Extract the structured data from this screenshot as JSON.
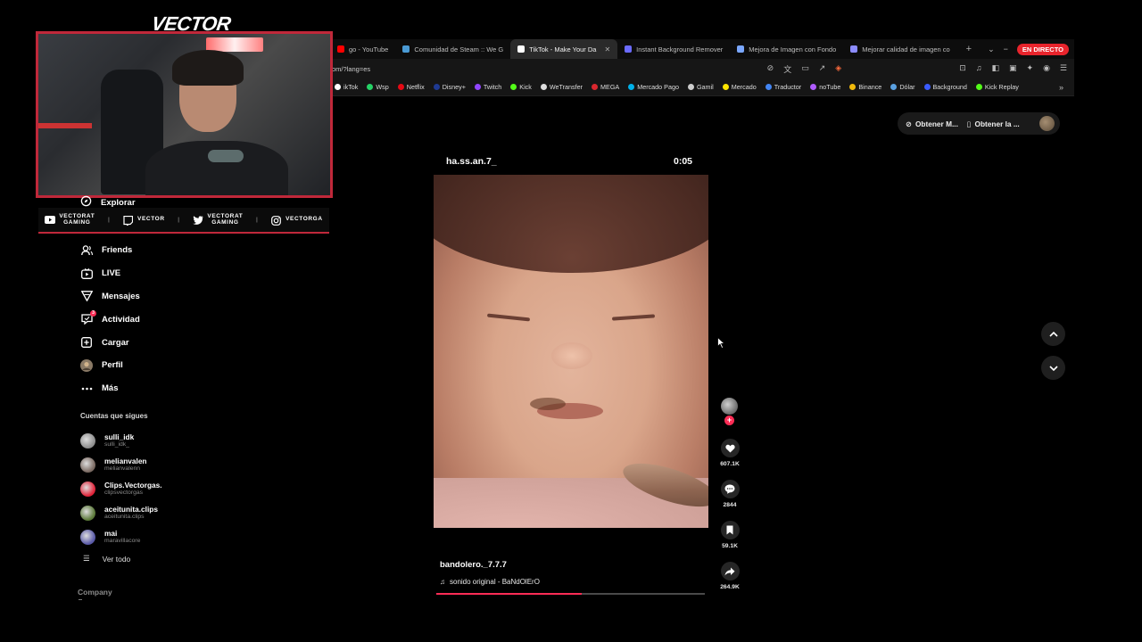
{
  "colors": {
    "accent": "#fe2c55",
    "live": "#e8242c",
    "webcam_border": "#c0283a"
  },
  "browser": {
    "tabs": [
      {
        "label": "go - YouTube",
        "icon": "youtube-icon",
        "color": "#ff0000",
        "active": false
      },
      {
        "label": "Comunidad de Steam :: We G",
        "icon": "steam-icon",
        "color": "#4a9ad4",
        "active": false
      },
      {
        "label": "TikTok - Make Your Da",
        "icon": "tiktok-icon",
        "color": "#ffffff",
        "active": true
      },
      {
        "label": "Instant Background Remover",
        "icon": "remover-icon",
        "color": "#6b6bff",
        "active": false
      },
      {
        "label": "Mejora de Imagen con Fondo",
        "icon": "sparkle-icon",
        "color": "#7aa7ff",
        "active": false
      },
      {
        "label": "Mejorar calidad de imagen co",
        "icon": "image-icon",
        "color": "#8c8cff",
        "active": false
      }
    ],
    "live_label": "EN DIRECTO",
    "url": "om/?lang=es",
    "bookmarks": [
      {
        "label": "ikTok",
        "color": "#ffffff"
      },
      {
        "label": "Wsp",
        "color": "#25d366"
      },
      {
        "label": "Netflix",
        "color": "#e50914"
      },
      {
        "label": "Disney+",
        "color": "#1f3a93"
      },
      {
        "label": "Twitch",
        "color": "#9146ff"
      },
      {
        "label": "Kick",
        "color": "#53fc18"
      },
      {
        "label": "WeTransfer",
        "color": "#dddddd"
      },
      {
        "label": "MEGA",
        "color": "#d9272e"
      },
      {
        "label": "Mercado Pago",
        "color": "#00b1ea"
      },
      {
        "label": "Gamil",
        "color": "#cccccc"
      },
      {
        "label": "Mercado",
        "color": "#ffe600"
      },
      {
        "label": "Traductor",
        "color": "#4285f4"
      },
      {
        "label": "noTube",
        "color": "#b05cff"
      },
      {
        "label": "Binance",
        "color": "#f0b90b"
      },
      {
        "label": "Dólar",
        "color": "#5aa0e0"
      },
      {
        "label": "Background",
        "color": "#3a5bff"
      },
      {
        "label": "Kick Replay",
        "color": "#53fc18"
      }
    ]
  },
  "stream": {
    "brand": "VECTOR",
    "socials": [
      {
        "icon": "youtube-icon",
        "line1": "VECTORAT",
        "line2": "GAMING"
      },
      {
        "icon": "twitch-icon",
        "line1": "VECTOR",
        "line2": ""
      },
      {
        "icon": "twitter-icon",
        "line1": "VECTORAT",
        "line2": "GAMING"
      },
      {
        "icon": "instagram-icon",
        "line1": "VECTORGA",
        "line2": ""
      }
    ]
  },
  "sidebar": {
    "partial_item": "Explorar",
    "items": [
      {
        "label": "Friends",
        "icon": "friends-icon"
      },
      {
        "label": "LIVE",
        "icon": "live-icon"
      },
      {
        "label": "Mensajes",
        "icon": "messages-icon"
      },
      {
        "label": "Actividad",
        "icon": "activity-icon",
        "badge": "3"
      },
      {
        "label": "Cargar",
        "icon": "upload-icon"
      },
      {
        "label": "Perfil",
        "icon": "profile-icon"
      },
      {
        "label": "Más",
        "icon": "more-icon"
      }
    ],
    "following_title": "Cuentas que sigues",
    "following": [
      {
        "name": "sulli_idk",
        "handle": "sulli_idk_",
        "color": "#8f8f8f"
      },
      {
        "name": "melianvalen",
        "handle": "melianvalenn",
        "color": "#7a6a62"
      },
      {
        "name": "Clips.Vectorgas.",
        "handle": "clipsvectorgas",
        "color": "#e0243a"
      },
      {
        "name": "aceitunita.clips",
        "handle": "aceitunita.clips",
        "color": "#5c7a3a"
      },
      {
        "name": "mai",
        "handle": "maravillacore",
        "color": "#5a5aa8"
      }
    ],
    "see_all": "Ver todo",
    "company": "Company"
  },
  "top_actions": {
    "coins_label": "Obtener M...",
    "app_label": "Obtener la ..."
  },
  "video": {
    "overlay_user": "ha.ss.an.7_",
    "time": "0:05",
    "author": "bandolero._7.7.7",
    "sound": "sonido original - BaNdOlErO",
    "progress": 0.54
  },
  "actions": {
    "likes": "607.1K",
    "comments": "2844",
    "saves": "59.1K",
    "shares": "264.9K"
  }
}
